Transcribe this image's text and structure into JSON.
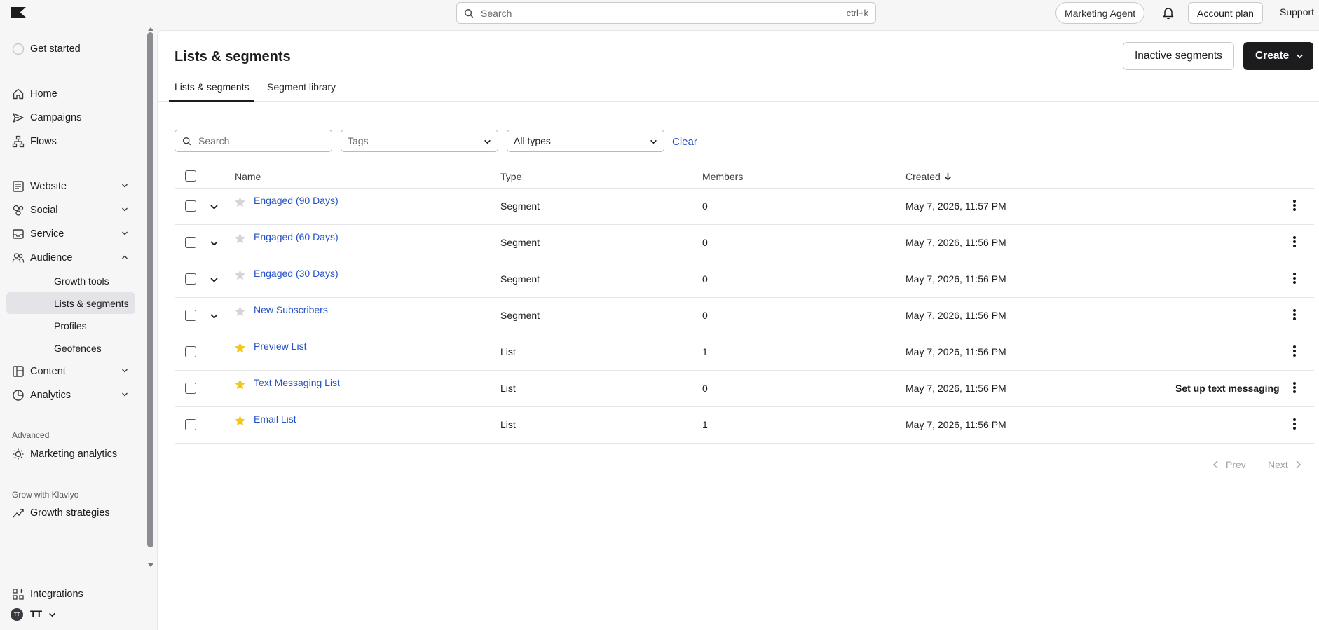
{
  "topbar": {
    "search_placeholder": "Search",
    "search_shortcut": "ctrl+k",
    "marketing_agent": "Marketing Agent",
    "account_plan": "Account plan",
    "support": "Support"
  },
  "sidebar": {
    "get_started": "Get started",
    "items": [
      {
        "label": "Home",
        "icon": "home-icon"
      },
      {
        "label": "Campaigns",
        "icon": "send-icon"
      },
      {
        "label": "Flows",
        "icon": "flows-icon"
      },
      {
        "label": "Website",
        "icon": "website-icon"
      },
      {
        "label": "Social",
        "icon": "social-icon"
      },
      {
        "label": "Service",
        "icon": "inbox-icon"
      },
      {
        "label": "Audience",
        "icon": "users-icon"
      },
      {
        "label": "Content",
        "icon": "content-icon"
      },
      {
        "label": "Analytics",
        "icon": "pie-chart-icon"
      }
    ],
    "audience_sub": [
      "Growth tools",
      "Lists & segments",
      "Profiles",
      "Geofences"
    ],
    "advanced_title": "Advanced",
    "marketing_analytics": "Marketing analytics",
    "grow_title": "Grow with Klaviyo",
    "growth_strategies": "Growth strategies",
    "integrations": "Integrations",
    "account_initials": "TT",
    "account_label": "TT"
  },
  "page": {
    "title": "Lists & segments",
    "inactive_segments": "Inactive segments",
    "create": "Create",
    "tabs": [
      "Lists & segments",
      "Segment library"
    ]
  },
  "filters": {
    "search_placeholder": "Search",
    "tags_placeholder": "Tags",
    "type_value": "All types",
    "clear": "Clear"
  },
  "table": {
    "headers": {
      "name": "Name",
      "type": "Type",
      "members": "Members",
      "created": "Created"
    },
    "rows": [
      {
        "name": "Engaged (90 Days)",
        "type": "Segment",
        "members": "0",
        "created": "May 7, 2026, 11:57 PM",
        "starred": false,
        "expandable": true,
        "action": ""
      },
      {
        "name": "Engaged (60 Days)",
        "type": "Segment",
        "members": "0",
        "created": "May 7, 2026, 11:56 PM",
        "starred": false,
        "expandable": true,
        "action": ""
      },
      {
        "name": "Engaged (30 Days)",
        "type": "Segment",
        "members": "0",
        "created": "May 7, 2026, 11:56 PM",
        "starred": false,
        "expandable": true,
        "action": ""
      },
      {
        "name": "New Subscribers",
        "type": "Segment",
        "members": "0",
        "created": "May 7, 2026, 11:56 PM",
        "starred": false,
        "expandable": true,
        "action": ""
      },
      {
        "name": "Preview List",
        "type": "List",
        "members": "1",
        "created": "May 7, 2026, 11:56 PM",
        "starred": true,
        "expandable": false,
        "action": ""
      },
      {
        "name": "Text Messaging List",
        "type": "List",
        "members": "0",
        "created": "May 7, 2026, 11:56 PM",
        "starred": true,
        "expandable": false,
        "action": "Set up text messaging"
      },
      {
        "name": "Email List",
        "type": "List",
        "members": "1",
        "created": "May 7, 2026, 11:56 PM",
        "starred": true,
        "expandable": false,
        "action": ""
      }
    ]
  },
  "pagination": {
    "prev": "Prev",
    "next": "Next"
  },
  "colors": {
    "link": "#2451c8",
    "star_active": "#f5c518",
    "star_inactive": "#d5d5d9",
    "primary": "#1c1c1e"
  }
}
